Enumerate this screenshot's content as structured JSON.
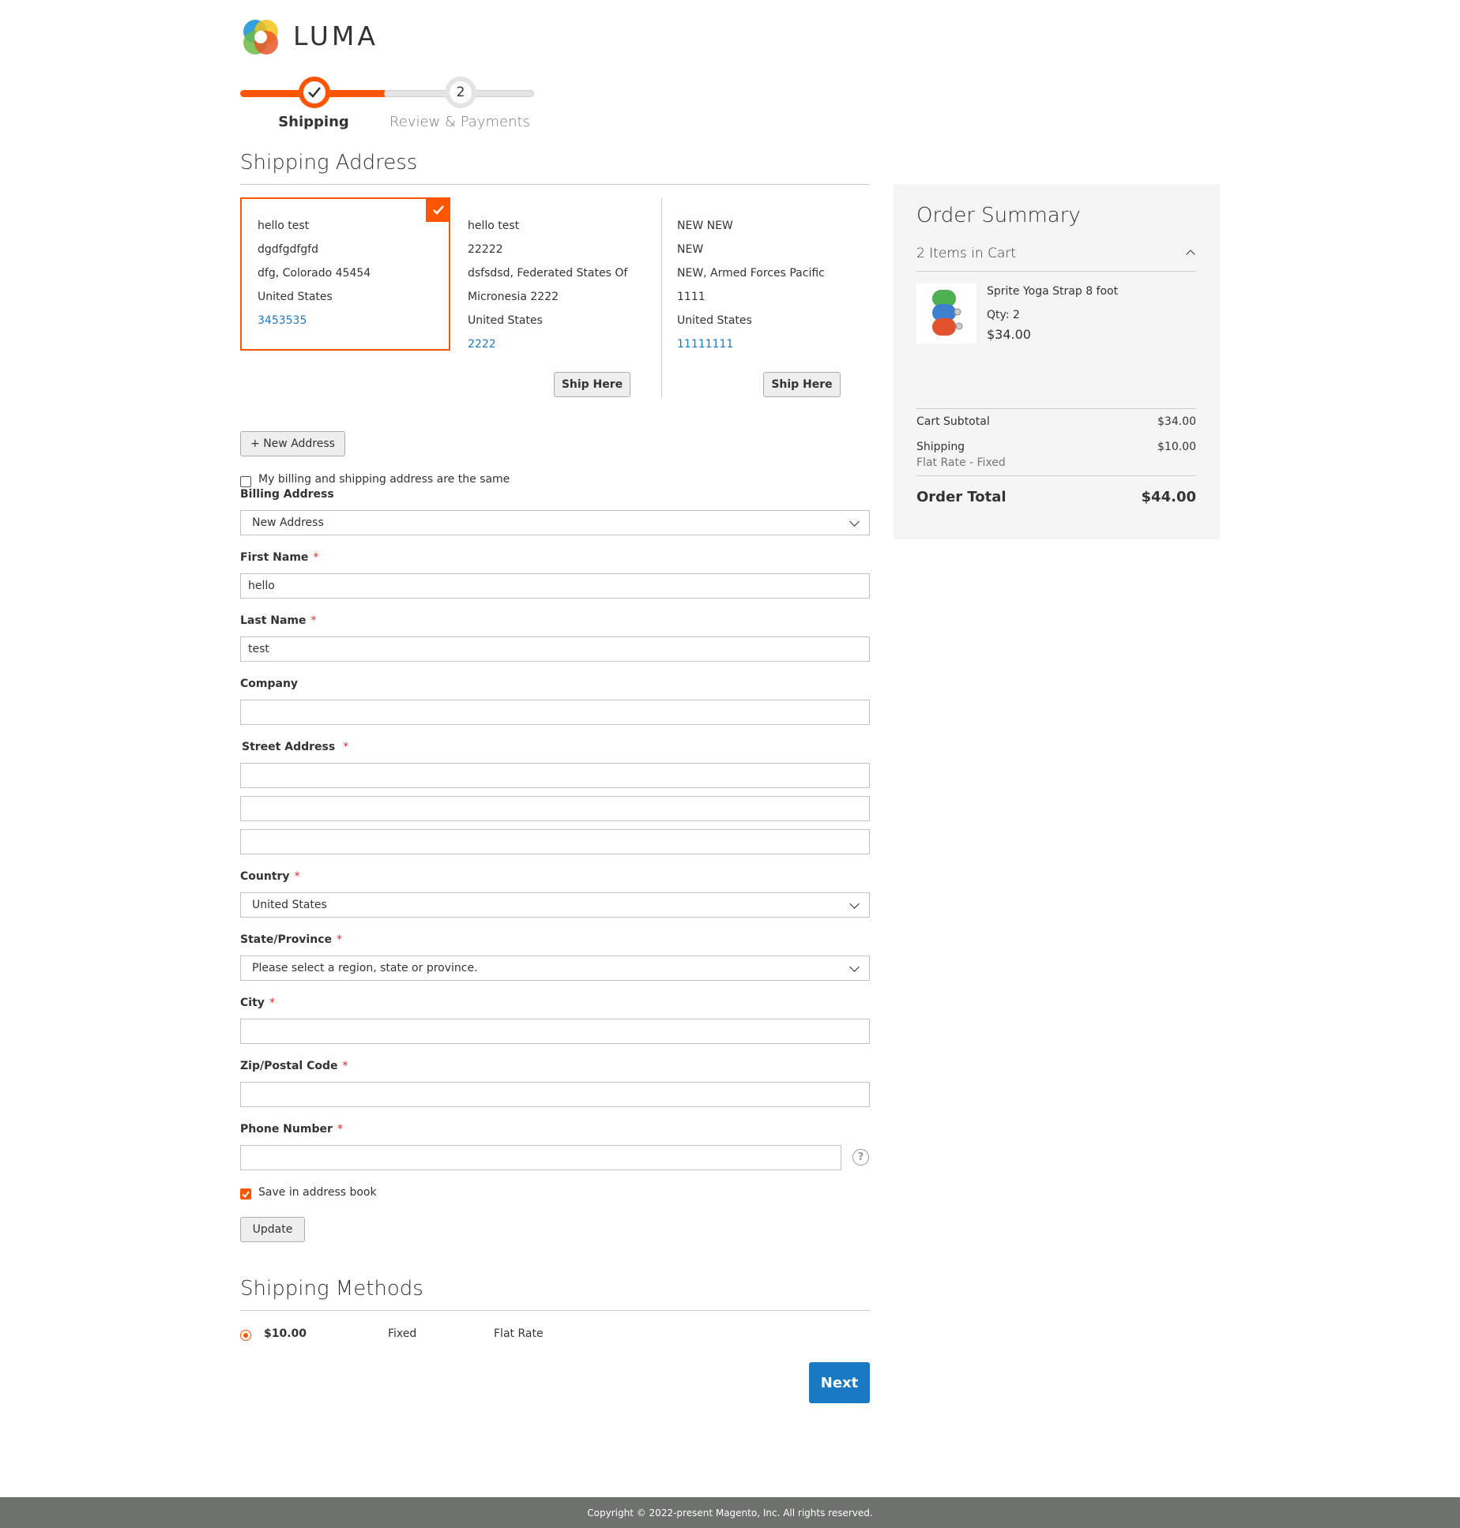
{
  "logo": {
    "text": "LUMA"
  },
  "progress": {
    "steps": [
      {
        "label": "Shipping",
        "state": "complete",
        "icon": "check-icon"
      },
      {
        "number": "2",
        "label": "Review & Payments",
        "state": "pending"
      }
    ],
    "colors": {
      "active": "#ff5501",
      "inactive": "#e4e4e4"
    }
  },
  "shipping_address": {
    "title": "Shipping Address",
    "cards": [
      {
        "lines": [
          "hello test",
          "dgdfgdfgfd",
          "dfg, Colorado 45454",
          "United States"
        ],
        "phone": "3453535",
        "selected": true
      },
      {
        "lines": [
          "hello test",
          "22222",
          "dsfsdsd, Federated States Of",
          "Micronesia 2222",
          "United States"
        ],
        "phone": "2222",
        "button": "Ship Here"
      },
      {
        "lines": [
          "NEW NEW",
          "NEW",
          "NEW, Armed Forces Pacific",
          "1111",
          "United States"
        ],
        "phone": "11111111",
        "button": "Ship Here"
      }
    ],
    "new_address_button": "+ New Address"
  },
  "billing": {
    "same_checkbox_label": "My billing and shipping address are the same",
    "same_checked": false,
    "label": "Billing Address",
    "selected": "New Address"
  },
  "form": {
    "first_name": {
      "label": "First Name",
      "value": "hello"
    },
    "last_name": {
      "label": "Last Name",
      "value": "test"
    },
    "company": {
      "label": "Company",
      "value": ""
    },
    "street": {
      "label": "Street Address",
      "values": [
        "",
        "",
        ""
      ]
    },
    "country": {
      "label": "Country",
      "selected": "United States"
    },
    "region": {
      "label": "State/Province",
      "selected": "Please select a region, state or province."
    },
    "city": {
      "label": "City",
      "value": ""
    },
    "zip": {
      "label": "Zip/Postal Code",
      "value": ""
    },
    "phone": {
      "label": "Phone Number",
      "value": "",
      "help_icon": "?"
    },
    "save_label": "Save in address book",
    "save_checked": true,
    "update_button": "Update",
    "required_mark": "*"
  },
  "shipping_methods": {
    "title": "Shipping Methods",
    "rate": {
      "price": "$10.00",
      "method": "Fixed",
      "carrier": "Flat Rate",
      "selected": true
    },
    "next_button": "Next"
  },
  "summary": {
    "title": "Order Summary",
    "items_label": "2 Items in Cart",
    "item": {
      "name": "Sprite Yoga Strap 8 foot",
      "qty": "Qty: 2",
      "price": "$34.00"
    },
    "subtotal_label": "Cart Subtotal",
    "subtotal_value": "$34.00",
    "shipping_label": "Shipping",
    "shipping_value": "$10.00",
    "shipping_method": "Flat Rate - Fixed",
    "total_label": "Order Total",
    "total_value": "$44.00"
  },
  "footer": {
    "text": "Copyright © 2022-present Magento, Inc. All rights reserved."
  }
}
